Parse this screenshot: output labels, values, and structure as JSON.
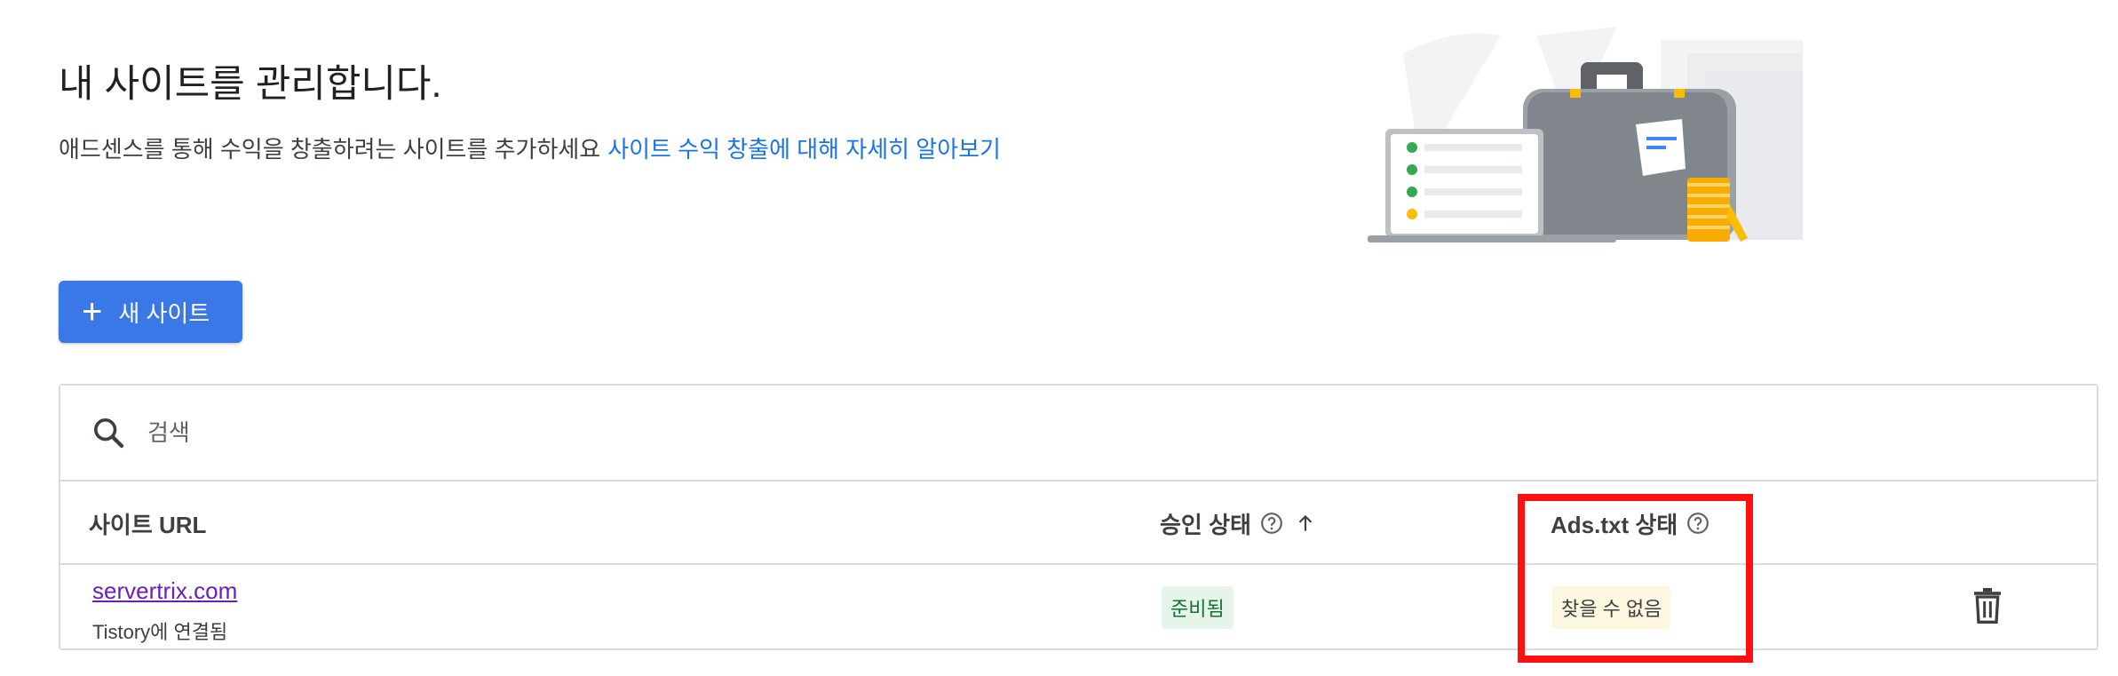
{
  "header": {
    "title": "내 사이트를 관리합니다.",
    "subtitle": "애드센스를 통해 수익을 창출하려는 사이트를 추가하세요",
    "learn_more_link": "사이트 수익 창출에 대해 자세히 알아보기"
  },
  "toolbar": {
    "new_site_label": "새 사이트"
  },
  "search": {
    "placeholder": "검색"
  },
  "table": {
    "columns": {
      "site_url": "사이트 URL",
      "approval_status": "승인 상태",
      "ads_txt_status": "Ads.txt 상태"
    },
    "rows": [
      {
        "url": "servertrix.com",
        "sub": "Tistory에 연결됨",
        "approval": "준비됨",
        "ads_txt": "찾을 수 없음"
      }
    ]
  },
  "colors": {
    "primary_button": "#3b78e7",
    "link": "#1a73e8",
    "visited_link": "#6a1fb8",
    "approve_chip_bg": "#e6f4ea",
    "ads_chip_bg": "#fef7e0",
    "highlight": "#ff1010"
  },
  "icons": [
    "search-icon",
    "plus-icon",
    "help-icon",
    "arrow-up-icon",
    "trash-icon"
  ]
}
